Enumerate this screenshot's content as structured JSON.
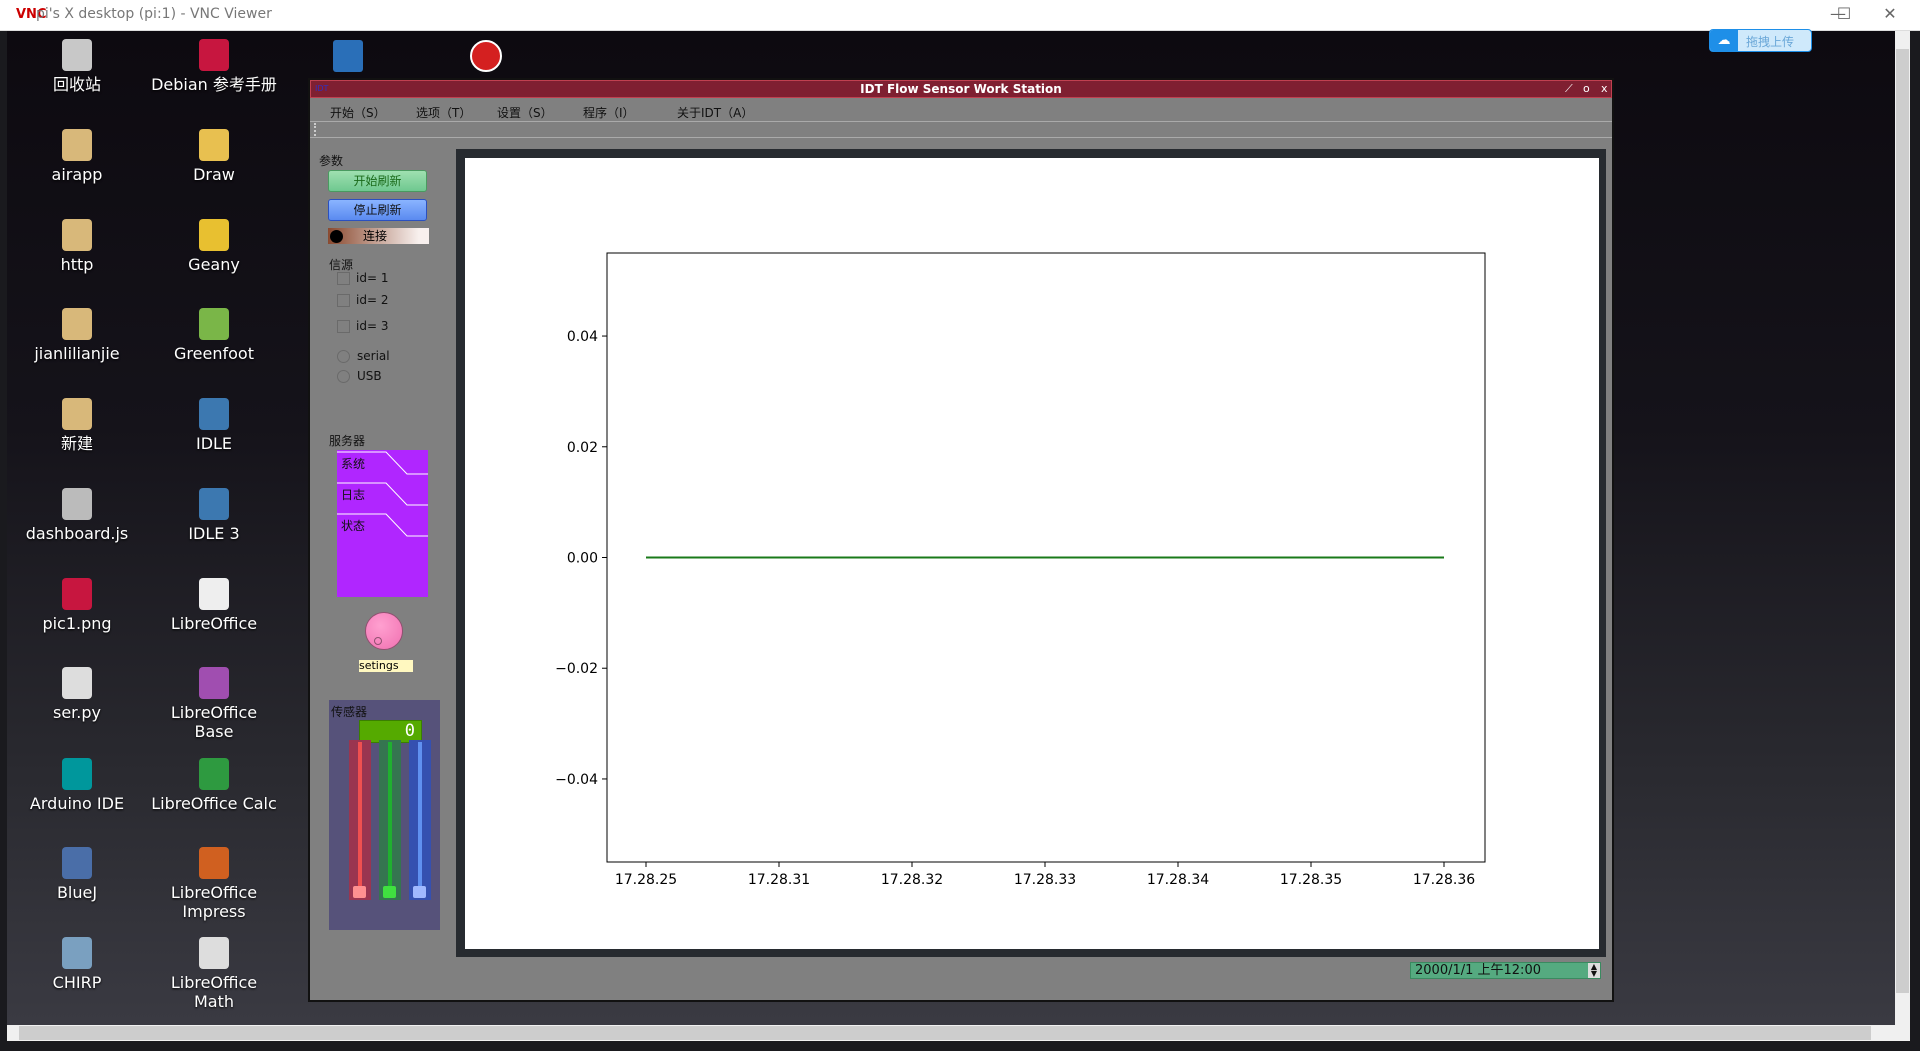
{
  "vnc": {
    "title": "pi's X desktop (pi:1) - VNC Viewer",
    "logo": "VNC",
    "minimize": "—",
    "maximize": "☐",
    "close": "✕"
  },
  "desktop_icons": [
    {
      "label": "回收站",
      "icon": "trash-icon",
      "color": "#c8c8c8"
    },
    {
      "label": "Debian 参考手册",
      "icon": "debian-book-icon",
      "color": "#c7163f"
    },
    {
      "label": "airapp",
      "icon": "folder-icon",
      "color": "#d8b87a"
    },
    {
      "label": "Draw",
      "icon": "draw-icon",
      "color": "#e8c050"
    },
    {
      "label": "http",
      "icon": "folder-icon",
      "color": "#d8b87a"
    },
    {
      "label": "Geany",
      "icon": "geany-icon",
      "color": "#e8c030"
    },
    {
      "label": "jianlilianjie",
      "icon": "folder-icon",
      "color": "#d8b87a"
    },
    {
      "label": "Greenfoot",
      "icon": "greenfoot-icon",
      "color": "#7ab648"
    },
    {
      "label": "新建",
      "icon": "folder-icon",
      "color": "#d8b87a"
    },
    {
      "label": "IDLE",
      "icon": "python-icon",
      "color": "#3c78b0"
    },
    {
      "label": "dashboard.js",
      "icon": "script-file-icon",
      "color": "#bbbbbb"
    },
    {
      "label": "IDLE 3",
      "icon": "python-icon",
      "color": "#3c78b0"
    },
    {
      "label": "pic1.png",
      "icon": "image-file-icon",
      "color": "#c7163f"
    },
    {
      "label": "LibreOffice",
      "icon": "libreoffice-icon",
      "color": "#eeeeee"
    },
    {
      "label": "ser.py",
      "icon": "text-file-icon",
      "color": "#dddddd"
    },
    {
      "label": "LibreOffice Base",
      "icon": "libreoffice-base-icon",
      "color": "#a04eb0"
    },
    {
      "label": "Arduino IDE",
      "icon": "arduino-icon",
      "color": "#00979c"
    },
    {
      "label": "LibreOffice Calc",
      "icon": "libreoffice-calc-icon",
      "color": "#2e9a40"
    },
    {
      "label": "BlueJ",
      "icon": "bluej-icon",
      "color": "#4a6ea8"
    },
    {
      "label": "LibreOffice Impress",
      "icon": "libreoffice-impress-icon",
      "color": "#d06020"
    },
    {
      "label": "CHIRP",
      "icon": "chirp-icon",
      "color": "#7aa0c0"
    },
    {
      "label": "LibreOffice Math",
      "icon": "libreoffice-math-icon",
      "color": "#dddddd"
    }
  ],
  "top_icons": [
    {
      "icon": "libreoffice-writer-icon",
      "color": "#2a6fb8"
    },
    {
      "icon": "wolfram-icon",
      "color": "#d42020"
    }
  ],
  "upload": {
    "label": "拖拽上传",
    "icon": "baidu-cloud-icon"
  },
  "app": {
    "title": "IDT Flow Sensor Work Station",
    "title_icon": "IDT",
    "title_buttons": [
      "⟋",
      "o",
      "x"
    ],
    "menu": [
      "开始（S）",
      "选项（T）",
      "设置（S）",
      "程序（I）",
      "关于IDT（A）"
    ],
    "params_label": "参数",
    "start_button": "开始刷新",
    "stop_button": "停止刷新",
    "connect_label": "连接",
    "source_label": "信源",
    "checkboxes": [
      {
        "label": "id= 1",
        "checked": false
      },
      {
        "label": "id= 2",
        "checked": false
      },
      {
        "label": "id= 3",
        "checked": false
      }
    ],
    "radios": [
      {
        "label": "serial",
        "selected": false
      },
      {
        "label": "USB",
        "selected": false
      }
    ],
    "server_label": "服务器",
    "server_tabs": [
      "系统",
      "日志",
      "状态"
    ],
    "server_color": "#b026ff",
    "knob_label": "setings",
    "sensor_label": "传感器",
    "lcd_value": "0",
    "sliders": [
      {
        "color": "red",
        "value": 0
      },
      {
        "color": "green",
        "value": 0
      },
      {
        "color": "blue",
        "value": 0
      }
    ],
    "datetime": "2000/1/1 上午12:00"
  },
  "chart_data": {
    "type": "line",
    "x": [
      "17.28.25",
      "17.28.31",
      "17.28.32",
      "17.28.33",
      "17.28.34",
      "17.28.35",
      "17.28.36"
    ],
    "series": [
      {
        "values": [
          0,
          0,
          0,
          0,
          0,
          0,
          0
        ],
        "color": "#1a7a1a"
      }
    ],
    "yticks": [
      0.04,
      0.02,
      0.0,
      -0.02,
      -0.04
    ],
    "ytick_labels": [
      "0.04",
      "0.02",
      "0.00",
      "−0.02",
      "−0.04"
    ],
    "ylim": [
      -0.055,
      0.055
    ],
    "grid": false
  }
}
